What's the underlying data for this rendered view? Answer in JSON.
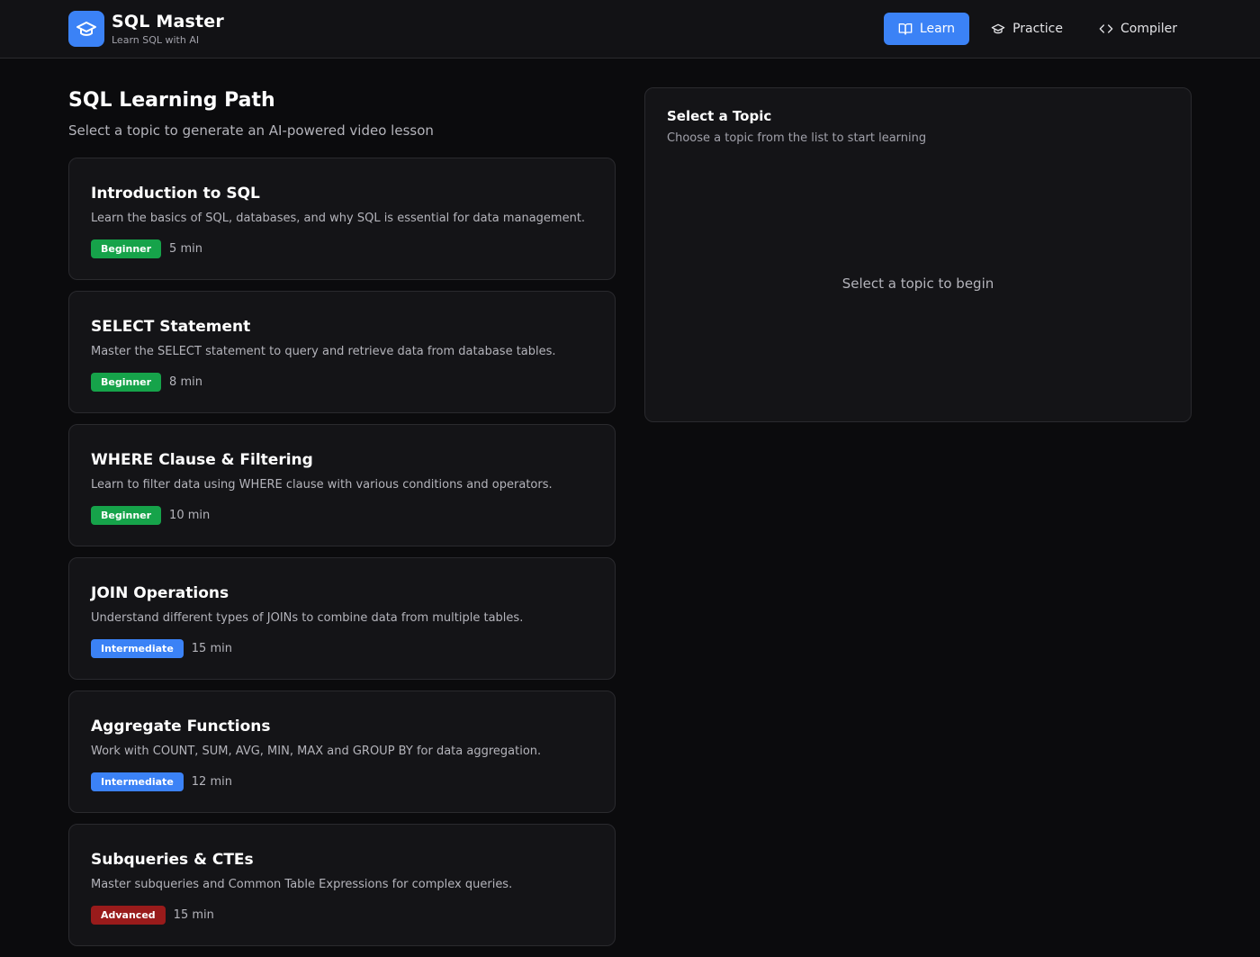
{
  "app": {
    "title": "SQL Master",
    "subtitle": "Learn SQL with AI"
  },
  "nav": {
    "items": [
      {
        "label": "Learn",
        "icon": "book-open-icon",
        "active": true
      },
      {
        "label": "Practice",
        "icon": "graduation-cap-icon",
        "active": false
      },
      {
        "label": "Compiler",
        "icon": "code-icon",
        "active": false
      }
    ]
  },
  "main": {
    "title": "SQL Learning Path",
    "subtitle": "Select a topic to generate an AI-powered video lesson"
  },
  "topics": [
    {
      "title": "Introduction to SQL",
      "description": "Learn the basics of SQL, databases, and why SQL is essential for data management.",
      "level": "Beginner",
      "duration": "5 min"
    },
    {
      "title": "SELECT Statement",
      "description": "Master the SELECT statement to query and retrieve data from database tables.",
      "level": "Beginner",
      "duration": "8 min"
    },
    {
      "title": "WHERE Clause & Filtering",
      "description": "Learn to filter data using WHERE clause with various conditions and operators.",
      "level": "Beginner",
      "duration": "10 min"
    },
    {
      "title": "JOIN Operations",
      "description": "Understand different types of JOINs to combine data from multiple tables.",
      "level": "Intermediate",
      "duration": "15 min"
    },
    {
      "title": "Aggregate Functions",
      "description": "Work with COUNT, SUM, AVG, MIN, MAX and GROUP BY for data aggregation.",
      "level": "Intermediate",
      "duration": "12 min"
    },
    {
      "title": "Subqueries & CTEs",
      "description": "Master subqueries and Common Table Expressions for complex queries.",
      "level": "Advanced",
      "duration": "15 min"
    }
  ],
  "level_colors": {
    "Beginner": "#16a34a",
    "Intermediate": "#3b82f6",
    "Advanced": "#991b1b"
  },
  "panel": {
    "title": "Select a Topic",
    "subtitle": "Choose a topic from the list to start learning",
    "empty": "Select a topic to begin"
  },
  "colors": {
    "accent": "#3b82f6",
    "background": "#0b0b0d",
    "card": "#141417"
  }
}
